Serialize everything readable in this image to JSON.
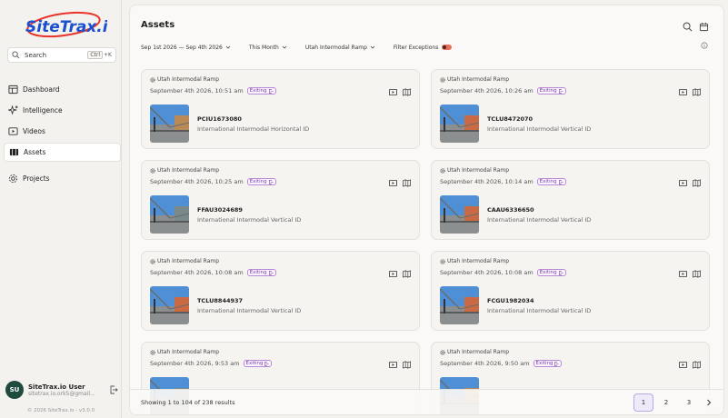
{
  "app": {
    "logo_text": "SiteTrax.io",
    "copyright": "© 2026 SiteTrax.io - v3.0.0"
  },
  "search": {
    "label": "Search",
    "shortcut_key1": "Ctrl",
    "shortcut_key2": "+K"
  },
  "sidebar": {
    "items": [
      {
        "label": "Dashboard",
        "icon": "dashboard-icon"
      },
      {
        "label": "Intelligence",
        "icon": "sparkle-icon"
      },
      {
        "label": "Videos",
        "icon": "video-icon"
      },
      {
        "label": "Assets",
        "icon": "assets-icon",
        "active": true
      },
      {
        "label": "Projects",
        "icon": "gear-icon"
      }
    ]
  },
  "user": {
    "initials": "SU",
    "name": "SiteTrax.io User",
    "email": "sitetrax.io.ork5@gmail..."
  },
  "header": {
    "title": "Assets"
  },
  "filters": {
    "date_range": "Sep 1st 2026 — Sep 4th 2026",
    "period": "This Month",
    "location": "Utah Intermodal Ramp",
    "exceptions": "Filter Exceptions"
  },
  "cards": [
    {
      "location": "Utah Intermodal Ramp",
      "datetime": "September 4th 2026, 10:51 am",
      "status": "Exiting",
      "asset_id": "PCIU1673080",
      "asset_type": "International Intermodal Horizontal ID"
    },
    {
      "location": "Utah Intermodal Ramp",
      "datetime": "September 4th 2026, 10:26 am",
      "status": "Exiting",
      "asset_id": "TCLU8472070",
      "asset_type": "International Intermodal Vertical ID"
    },
    {
      "location": "Utah Intermodal Ramp",
      "datetime": "September 4th 2026, 10:25 am",
      "status": "Exiting",
      "asset_id": "FFAU3024689",
      "asset_type": "International Intermodal Vertical ID"
    },
    {
      "location": "Utah Intermodal Ramp",
      "datetime": "September 4th 2026, 10:14 am",
      "status": "Exiting",
      "asset_id": "CAAU6336650",
      "asset_type": "International Intermodal Vertical ID"
    },
    {
      "location": "Utah Intermodal Ramp",
      "datetime": "September 4th 2026, 10:08 am",
      "status": "Exiting",
      "asset_id": "TCLU8844937",
      "asset_type": "International Intermodal Vertical ID"
    },
    {
      "location": "Utah Intermodal Ramp",
      "datetime": "September 4th 2026, 10:08 am",
      "status": "Exiting",
      "asset_id": "FCGU1982034",
      "asset_type": "International Intermodal Vertical ID"
    },
    {
      "location": "Utah Intermodal Ramp",
      "datetime": "September 4th 2026, 9:53 am",
      "status": "Exiting",
      "asset_id": "",
      "asset_type": ""
    },
    {
      "location": "Utah Intermodal Ramp",
      "datetime": "September 4th 2026, 9:50 am",
      "status": "Exiting",
      "asset_id": "",
      "asset_type": ""
    }
  ],
  "pagination": {
    "showing": "Showing 1 to 104 of 238 results",
    "pages": [
      "1",
      "2",
      "3"
    ],
    "current": "1"
  },
  "colors": {
    "accent": "#7a3aa8",
    "brand_blue": "#1a4fd0",
    "brand_red": "#e8352b",
    "toggle": "#e7725a",
    "avatar": "#1f4a3e"
  }
}
